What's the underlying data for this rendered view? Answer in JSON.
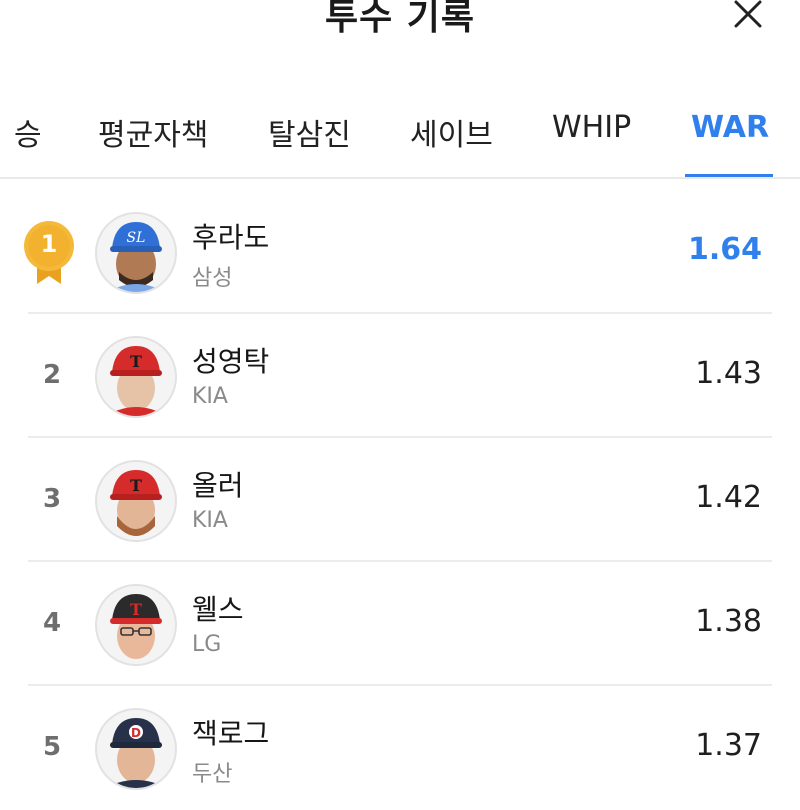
{
  "header": {
    "title": "투수 기록",
    "close_icon": "close-icon"
  },
  "tabs": [
    {
      "label": "승"
    },
    {
      "label": "평균자책"
    },
    {
      "label": "탈삼진"
    },
    {
      "label": "세이브"
    },
    {
      "label": "WHIP"
    },
    {
      "label": "WAR",
      "active": true
    }
  ],
  "colors": {
    "accent": "#2f80ed",
    "gold_medal": "#f2b230"
  },
  "players": [
    {
      "rank": "1",
      "name": "후라도",
      "team": "삼성",
      "value": "1.64",
      "medal": "gold-medal-icon",
      "cap": "#2f6fd6",
      "cap_logo": "SL"
    },
    {
      "rank": "2",
      "name": "성영탁",
      "team": "KIA",
      "value": "1.43",
      "cap": "#d62b2b",
      "cap_logo": "T"
    },
    {
      "rank": "3",
      "name": "올러",
      "team": "KIA",
      "value": "1.42",
      "cap": "#d62b2b",
      "cap_logo": "T"
    },
    {
      "rank": "4",
      "name": "웰스",
      "team": "LG",
      "value": "1.38",
      "cap": "#2b2b2b",
      "cap_logo": "T"
    },
    {
      "rank": "5",
      "name": "잭로그",
      "team": "두산",
      "value": "1.37",
      "cap": "#27324a",
      "cap_logo": "D"
    }
  ]
}
